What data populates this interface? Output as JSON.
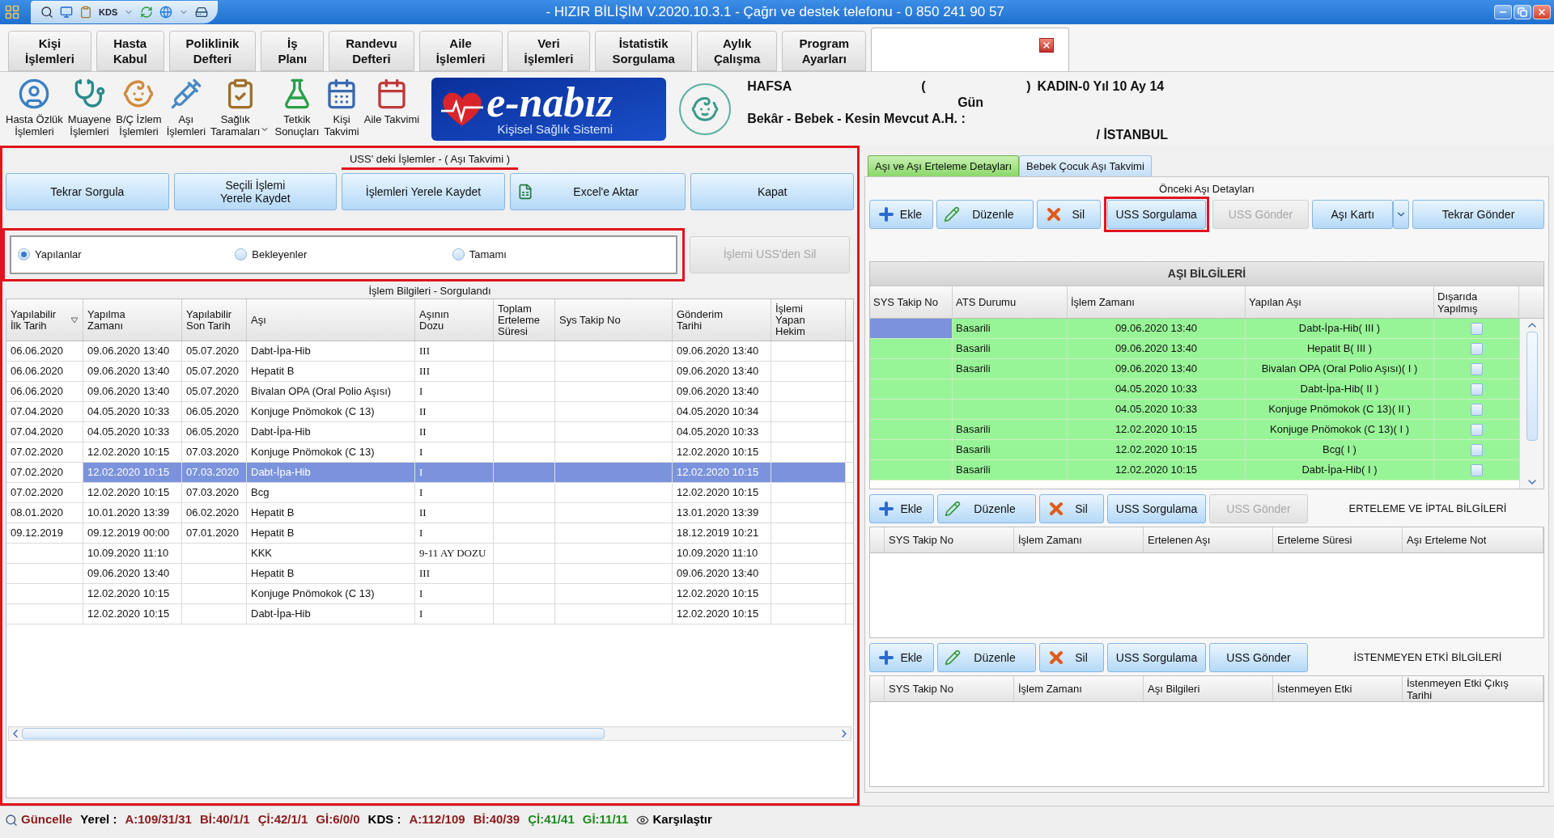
{
  "window": {
    "title": "- HIZIR BİLİŞİM V.2020.10.3.1 - Çağrı ve destek telefonu - 0 850 241 90 57"
  },
  "quick_access": {
    "label": "KDS"
  },
  "menu_tabs": [
    {
      "label": "Kişi\nİşlemleri",
      "selected": false,
      "closable": false
    },
    {
      "label": "Hasta\nKabul",
      "selected": false,
      "closable": false
    },
    {
      "label": "Poliklinik\nDefteri",
      "selected": false,
      "closable": false
    },
    {
      "label": "İş\nPlanı",
      "selected": false,
      "closable": false
    },
    {
      "label": "Randevu\nDefteri",
      "selected": false,
      "closable": false
    },
    {
      "label": "Aile\nİşlemleri",
      "selected": false,
      "closable": false
    },
    {
      "label": "Veri\nİşlemleri",
      "selected": false,
      "closable": false
    },
    {
      "label": "İstatistik\nSorgulama",
      "selected": false,
      "closable": false
    },
    {
      "label": "Aylık\nÇalışma",
      "selected": false,
      "closable": false
    },
    {
      "label": "Program\nAyarları",
      "selected": false,
      "closable": false
    },
    {
      "selected": true,
      "closable": true
    }
  ],
  "toolbar": [
    {
      "label": "Hasta Özlük\nİşlemleri",
      "dropdown": false
    },
    {
      "label": "Muayene\nİşlemleri",
      "dropdown": false
    },
    {
      "label": "B/Ç İzlem\nİşlemleri",
      "dropdown": false
    },
    {
      "label": "Aşı\nİşlemleri",
      "dropdown": false
    },
    {
      "label": "Sağlık\nTaramaları",
      "dropdown": true
    },
    {
      "label": "Tetkik\nSonuçları",
      "dropdown": false
    },
    {
      "label": "Kişi\nTakvimi",
      "dropdown": false
    },
    {
      "label": "Aile Takvimi",
      "dropdown": false
    }
  ],
  "logo": {
    "title": "e-nabız",
    "subtitle": "Kişisel Sağlık Sistemi"
  },
  "patient": {
    "name": "HAFSA",
    "open_paren": "(",
    "close_paren": ")",
    "summary": "KADIN-0 Yıl 10 Ay 14",
    "summary_end": "Gün",
    "status": "Bekâr - Bebek - Kesin Mevcut A.H. :",
    "city": "/ İSTANBUL"
  },
  "left_panel": {
    "highlighted": true,
    "title": "USS' deki İşlemler - ( Aşı Takvimi )",
    "title_underlined": true,
    "buttons": [
      {
        "label": "Tekrar Sorgula",
        "kind": "plain"
      },
      {
        "label": "Seçili İşlemi\nYerele Kaydet",
        "kind": "plain"
      },
      {
        "label": "İşlemleri Yerele Kaydet",
        "kind": "plain"
      },
      {
        "label": "Excel'e Aktar",
        "kind": "excel"
      },
      {
        "label": "Kapat",
        "kind": "plain"
      }
    ],
    "filter": {
      "highlighted": true,
      "options": [
        {
          "label": "Yapılanlar",
          "selected": true
        },
        {
          "label": "Bekleyenler",
          "selected": false
        },
        {
          "label": "Tamamı",
          "selected": false
        }
      ]
    },
    "delete_button": {
      "label": "İşlemi USS'den Sil",
      "disabled": true
    },
    "table": {
      "caption": "İşlem Bilgileri - Sorgulandı",
      "columns": [
        {
          "label": "Yapılabilir\nİlk Tarih",
          "sorted": true
        },
        {
          "label": "Yapılma\nZamanı",
          "sorted": false
        },
        {
          "label": "Yapılabilir\nSon Tarih",
          "sorted": false
        },
        {
          "label": "Aşı",
          "sorted": false
        },
        {
          "label": "Aşının\nDozu",
          "sorted": false
        },
        {
          "label": "Toplam\nErteleme\nSüresi",
          "sorted": false
        },
        {
          "label": "Sys Takip No",
          "sorted": false
        },
        {
          "label": "Gönderim\nTarihi",
          "sorted": false
        },
        {
          "label": "İşlemi\nYapan\nHekim",
          "sorted": false
        }
      ],
      "rows": [
        {
          "selected": false,
          "cells": [
            "06.06.2020",
            "09.06.2020 13:40",
            "05.07.2020",
            "Dabt-İpa-Hib",
            "III",
            null,
            null,
            "09.06.2020 13:40",
            null
          ]
        },
        {
          "selected": false,
          "cells": [
            "06.06.2020",
            "09.06.2020 13:40",
            "05.07.2020",
            "Hepatit B",
            "III",
            null,
            null,
            "09.06.2020 13:40",
            null
          ]
        },
        {
          "selected": false,
          "cells": [
            "06.06.2020",
            "09.06.2020 13:40",
            "05.07.2020",
            "Bivalan OPA (Oral Polio Aşısı)",
            "I",
            null,
            null,
            "09.06.2020 13:40",
            null
          ]
        },
        {
          "selected": false,
          "cells": [
            "07.04.2020",
            "04.05.2020 10:33",
            "06.05.2020",
            "Konjuge Pnömokok (C 13)",
            "II",
            null,
            null,
            "04.05.2020 10:34",
            null
          ]
        },
        {
          "selected": false,
          "cells": [
            "07.04.2020",
            "04.05.2020 10:33",
            "06.05.2020",
            "Dabt-İpa-Hib",
            "II",
            null,
            null,
            "04.05.2020 10:33",
            null
          ]
        },
        {
          "selected": false,
          "cells": [
            "07.02.2020",
            "12.02.2020 10:15",
            "07.03.2020",
            "Konjuge Pnömokok (C 13)",
            "I",
            null,
            null,
            "12.02.2020 10:15",
            null
          ]
        },
        {
          "selected": true,
          "cells": [
            "07.02.2020",
            "12.02.2020 10:15",
            "07.03.2020",
            "Dabt-İpa-Hib",
            "I",
            null,
            null,
            "12.02.2020 10:15",
            null
          ]
        },
        {
          "selected": false,
          "cells": [
            "07.02.2020",
            "12.02.2020 10:15",
            "07.03.2020",
            "Bcg",
            "I",
            null,
            null,
            "12.02.2020 10:15",
            null
          ]
        },
        {
          "selected": false,
          "cells": [
            "08.01.2020",
            "10.01.2020 13:39",
            "06.02.2020",
            "Hepatit B",
            "II",
            null,
            null,
            "13.01.2020 13:39",
            null
          ]
        },
        {
          "selected": false,
          "cells": [
            "09.12.2019",
            "09.12.2019 00:00",
            "07.01.2020",
            "Hepatit B",
            "I",
            null,
            null,
            "18.12.2019 10:21",
            null
          ]
        },
        {
          "selected": false,
          "cells": [
            null,
            "10.09.2020 11:10",
            null,
            "KKK",
            "9-11 AY DOZU",
            null,
            null,
            "10.09.2020 11:10",
            null
          ]
        },
        {
          "selected": false,
          "cells": [
            null,
            "09.06.2020 13:40",
            null,
            "Hepatit B",
            "III",
            null,
            null,
            "09.06.2020 13:40",
            null
          ]
        },
        {
          "selected": false,
          "cells": [
            null,
            "12.02.2020 10:15",
            null,
            "Konjuge Pnömokok (C 13)",
            "I",
            null,
            null,
            "12.02.2020 10:15",
            null
          ]
        },
        {
          "selected": false,
          "cells": [
            null,
            "12.02.2020 10:15",
            null,
            "Dabt-İpa-Hib",
            "I",
            null,
            null,
            "12.02.2020 10:15",
            null
          ]
        }
      ]
    }
  },
  "right_panel": {
    "tabs": [
      {
        "label": "Aşı ve Aşı Erteleme Detayları",
        "selected": true
      },
      {
        "label": "Bebek Çocuk Aşı Takvimi",
        "selected": false
      }
    ],
    "group_title": "Önceki Aşı Detayları",
    "buttons": [
      {
        "label": "Ekle",
        "kind": "add",
        "disabled": false,
        "highlighted": false
      },
      {
        "label": "Düzenle",
        "kind": "edit",
        "disabled": false,
        "highlighted": false
      },
      {
        "label": "Sil",
        "kind": "delete",
        "disabled": false,
        "highlighted": false
      },
      {
        "label": "USS Sorgulama",
        "kind": "plain",
        "disabled": false,
        "highlighted": true
      },
      {
        "label": "USS Gönder",
        "kind": "plain",
        "disabled": true,
        "highlighted": false
      },
      {
        "label": "Aşı Kartı",
        "kind": "split",
        "disabled": false,
        "highlighted": false
      },
      {
        "label": "Tekrar Gönder",
        "kind": "plain",
        "disabled": false,
        "highlighted": false
      }
    ],
    "grid": {
      "title": "AŞI BİLGİLERİ",
      "columns": [
        "SYS Takip No",
        "ATS Durumu",
        "İşlem Zamanı",
        "Yapılan Aşı",
        "Dışarıda\nYapılmış"
      ],
      "rows": [
        {
          "selected": true,
          "status": "Basarili",
          "time": "09.06.2020 13:40",
          "vaccine": "Dabt-İpa-Hib( III )",
          "external": false
        },
        {
          "selected": false,
          "status": "Basarili",
          "time": "09.06.2020 13:40",
          "vaccine": "Hepatit B( III )",
          "external": false
        },
        {
          "selected": false,
          "status": "Basarili",
          "time": "09.06.2020 13:40",
          "vaccine": "Bivalan OPA (Oral Polio Aşısı)( I )",
          "external": false
        },
        {
          "selected": false,
          "time": "04.05.2020 10:33",
          "vaccine": "Dabt-İpa-Hib( II )",
          "external": false
        },
        {
          "selected": false,
          "time": "04.05.2020 10:33",
          "vaccine": "Konjuge Pnömokok (C 13)( II )",
          "external": false
        },
        {
          "selected": false,
          "status": "Basarili",
          "time": "12.02.2020 10:15",
          "vaccine": "Konjuge Pnömokok (C 13)( I )",
          "external": false
        },
        {
          "selected": false,
          "status": "Basarili",
          "time": "12.02.2020 10:15",
          "vaccine": "Bcg( I )",
          "external": false
        },
        {
          "selected": false,
          "status": "Basarili",
          "time": "12.02.2020 10:15",
          "vaccine": "Dabt-İpa-Hib( I )",
          "external": false
        }
      ]
    },
    "sections": [
      {
        "title": "ERTELEME VE İPTAL BİLGİLERİ",
        "buttons": [
          {
            "label": "Ekle",
            "kind": "add",
            "disabled": false
          },
          {
            "label": "Düzenle",
            "kind": "edit",
            "disabled": false
          },
          {
            "label": "Sil",
            "kind": "delete",
            "disabled": false
          },
          {
            "label": "USS Sorgulama",
            "kind": "plain",
            "disabled": false
          },
          {
            "label": "USS Gönder",
            "kind": "plain",
            "disabled": true
          }
        ],
        "columns": [
          "SYS Takip No",
          "İşlem Zamanı",
          "Ertelenen Aşı",
          "Erteleme Süresi",
          "Aşı Erteleme Not"
        ]
      },
      {
        "title": "İSTENMEYEN ETKİ BİLGİLERİ",
        "buttons": [
          {
            "label": "Ekle",
            "kind": "add",
            "disabled": false
          },
          {
            "label": "Düzenle",
            "kind": "edit",
            "disabled": false
          },
          {
            "label": "Sil",
            "kind": "delete",
            "disabled": false
          },
          {
            "label": "USS Sorgulama",
            "kind": "plain",
            "disabled": false
          },
          {
            "label": "USS Gönder",
            "kind": "plain",
            "disabled": false
          }
        ],
        "columns": [
          "SYS Takip No",
          "İşlem Zamanı",
          "Aşı Bilgileri",
          "İstenmeyen Etki",
          "İstenmeyen Etki Çıkış\nTarihi"
        ]
      }
    ]
  },
  "status_bar": [
    {
      "text": "Güncelle",
      "kind": "search",
      "color": "#8b1a1a"
    },
    {
      "text": "Yerel :",
      "kind": "label",
      "color": "#000000"
    },
    {
      "text": "A:109/31/31",
      "kind": "count",
      "color": "#8b1a1a"
    },
    {
      "text": "Bİ:40/1/1",
      "kind": "count",
      "color": "#8b1a1a"
    },
    {
      "text": "Çİ:42/1/1",
      "kind": "count",
      "color": "#8b1a1a"
    },
    {
      "text": "Gİ:6/0/0",
      "kind": "count",
      "color": "#8b1a1a"
    },
    {
      "text": "KDS :",
      "kind": "label",
      "color": "#000000"
    },
    {
      "text": "A:112/109",
      "kind": "count",
      "color": "#8b1a1a"
    },
    {
      "text": "Bİ:40/39",
      "kind": "count",
      "color": "#8b1a1a"
    },
    {
      "text": "Çİ:41/41",
      "kind": "count",
      "color": "#1f8a1f"
    },
    {
      "text": "Gİ:11/11",
      "kind": "count",
      "color": "#1f8a1f"
    },
    {
      "text": "Karşılaştır",
      "kind": "compare",
      "color": "#000000"
    }
  ]
}
